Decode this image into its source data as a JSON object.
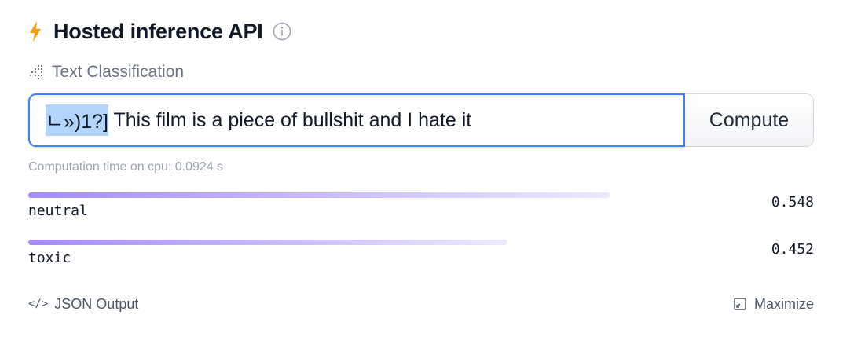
{
  "header": {
    "title": "Hosted inference API",
    "icon": "bolt-icon",
    "accent_color": "#f59e0b"
  },
  "task": {
    "label": "Text Classification",
    "icon": "text-classification-icon"
  },
  "input": {
    "selected_text": "ㄴ»)1?]",
    "value_rest": " This film is a piece of bullshit and I hate it"
  },
  "compute_button": {
    "label": "Compute"
  },
  "computation_time": "Computation time on cpu: 0.0924 s",
  "results": [
    {
      "label": "neutral",
      "score": "0.548",
      "fraction": 0.548
    },
    {
      "label": "toxic",
      "score": "0.452",
      "fraction": 0.452
    }
  ],
  "footer": {
    "json_output_label": "JSON Output",
    "maximize_label": "Maximize"
  },
  "colors": {
    "input_border": "#3b82f6",
    "selection": "#b4d5fb",
    "bar_start": "#a78bfa",
    "bar_end": "#ede9fe"
  }
}
